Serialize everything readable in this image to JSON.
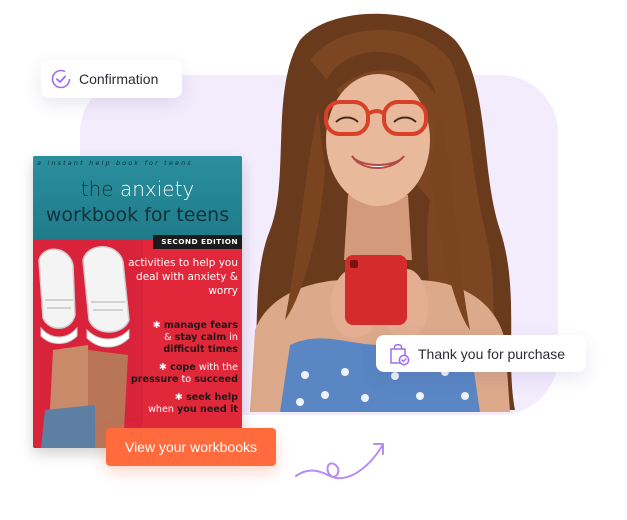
{
  "confirmation_card": {
    "label": "Confirmation",
    "icon": "check-circle-icon"
  },
  "purchase_card": {
    "label": "Thank you for purchase",
    "icon": "shopping-bag-check-icon"
  },
  "cta": {
    "label": "View your workbooks"
  },
  "book": {
    "series": "a  instant  help  book  for  teens",
    "title_line1_a": "the ",
    "title_line1_b": "anxiety",
    "title_line2": "workbook for teens",
    "edition": "SECOND EDITION",
    "subtitle": "activities to help you deal with anxiety & worry",
    "points": [
      {
        "a": "manage fears",
        "b": "& ",
        "c": "stay calm",
        "d": " in",
        "e": "difficult times"
      },
      {
        "a": "cope",
        "b": " with the",
        "c": "pressure",
        "d": " to ",
        "e": "succeed"
      },
      {
        "a": "seek help",
        "b": "when ",
        "c": "you need it"
      }
    ]
  },
  "colors": {
    "accent_purple": "#9b6ef3",
    "cta_orange": "#ff6b3d",
    "blob_lavender": "#f3ecfd"
  }
}
